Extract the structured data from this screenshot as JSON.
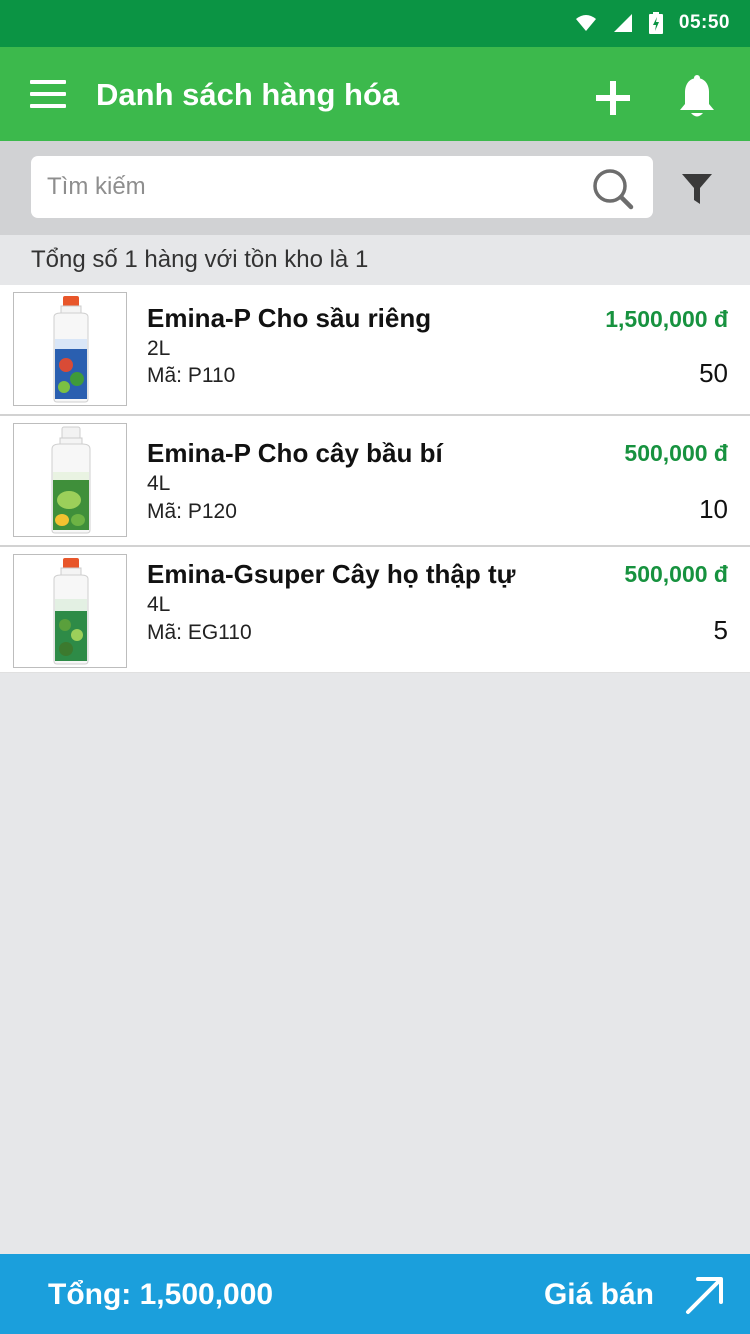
{
  "status_bar": {
    "time": "05:50",
    "icons": [
      "wifi-icon",
      "cell-signal-icon",
      "battery-charging-icon"
    ]
  },
  "app_bar": {
    "title": "Danh sách hàng hóa",
    "icons": [
      "menu-icon",
      "plus-icon",
      "bell-icon"
    ]
  },
  "search": {
    "placeholder": "Tìm kiếm",
    "value": "",
    "icons": [
      "search-icon",
      "filter-icon"
    ]
  },
  "summary": "Tổng số 1 hàng với tồn kho là 1",
  "products": [
    {
      "name": "Emina-P Cho sầu riêng",
      "size": "2L",
      "code": "Mã: P110",
      "price": "1,500,000 đ",
      "qty": "50",
      "bottle": {
        "cap": "#e8562a",
        "label": "#2a5fb0"
      }
    },
    {
      "name": "Emina-P Cho cây bầu bí",
      "size": "4L",
      "code": "Mã: P120",
      "price": "500,000 đ",
      "qty": "10",
      "bottle": {
        "cap": "#f2f2f2",
        "label": "#3f8f3a"
      }
    },
    {
      "name": "Emina-Gsuper Cây họ thập tự",
      "size": "4L",
      "code": "Mã: EG110",
      "price": "500,000 đ",
      "qty": "5",
      "bottle": {
        "cap": "#e8562a",
        "label": "#2e8b47"
      }
    }
  ],
  "bottom_bar": {
    "total": "Tổng: 1,500,000",
    "price_mode": "Giá bán",
    "icon": "arrow-up-right-icon"
  },
  "colors": {
    "status_bar": "#0b9444",
    "app_bar": "#3cb94c",
    "price_text": "#17923f",
    "bottom_bar": "#1b9fdc"
  }
}
